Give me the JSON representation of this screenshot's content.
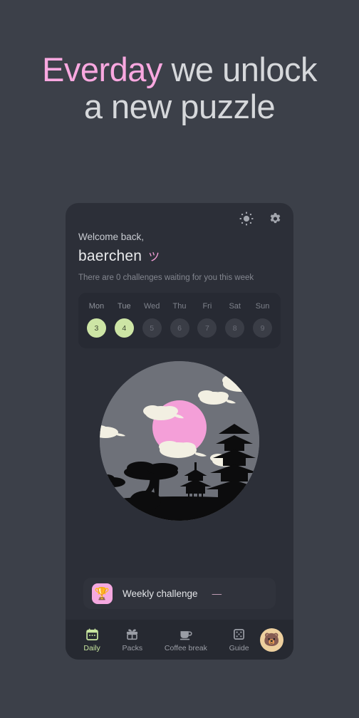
{
  "headline": {
    "accent_word": "Everday",
    "rest": " we unlock a new puzzle"
  },
  "colors": {
    "page_bg": "#3c4049",
    "card_bg": "#2c2f38",
    "accent_pink": "#f9a8e0",
    "accent_green": "#cde5a5",
    "nav_bg": "#262931",
    "moon_pink": "#f49fd8",
    "sky_gray": "#6e7179"
  },
  "card": {
    "top_actions": [
      {
        "name": "brightness-icon",
        "label": "Brightness"
      },
      {
        "name": "gear-icon",
        "label": "Settings"
      }
    ],
    "welcome_text": "Welcome back,",
    "username": "baerchen",
    "username_emoji": "ツ",
    "subnote": "There are 0 challenges waiting for you this week"
  },
  "week": {
    "days": [
      {
        "name": "Mon",
        "date": "3",
        "active": true
      },
      {
        "name": "Tue",
        "date": "4",
        "active": true
      },
      {
        "name": "Wed",
        "date": "5",
        "active": false
      },
      {
        "name": "Thu",
        "date": "6",
        "active": false
      },
      {
        "name": "Fri",
        "date": "7",
        "active": false
      },
      {
        "name": "Sat",
        "date": "8",
        "active": false
      },
      {
        "name": "Sun",
        "date": "9",
        "active": false
      }
    ]
  },
  "illustration": {
    "alt": "Night scene with pink moon, clouds, pagodas and trees"
  },
  "challenge": {
    "icon": "trophy-icon",
    "icon_glyph": "🏆",
    "label": "Weekly challenge",
    "dash": "—"
  },
  "nav": {
    "items": [
      {
        "label": "Daily",
        "icon": "calendar-icon",
        "active": true
      },
      {
        "label": "Packs",
        "icon": "gift-icon",
        "active": false
      },
      {
        "label": "Coffee break",
        "icon": "coffee-cup-icon",
        "active": false
      },
      {
        "label": "Guide",
        "icon": "dice-icon",
        "active": false
      }
    ],
    "avatar": {
      "name": "bear-avatar",
      "glyph": "🐻"
    }
  }
}
